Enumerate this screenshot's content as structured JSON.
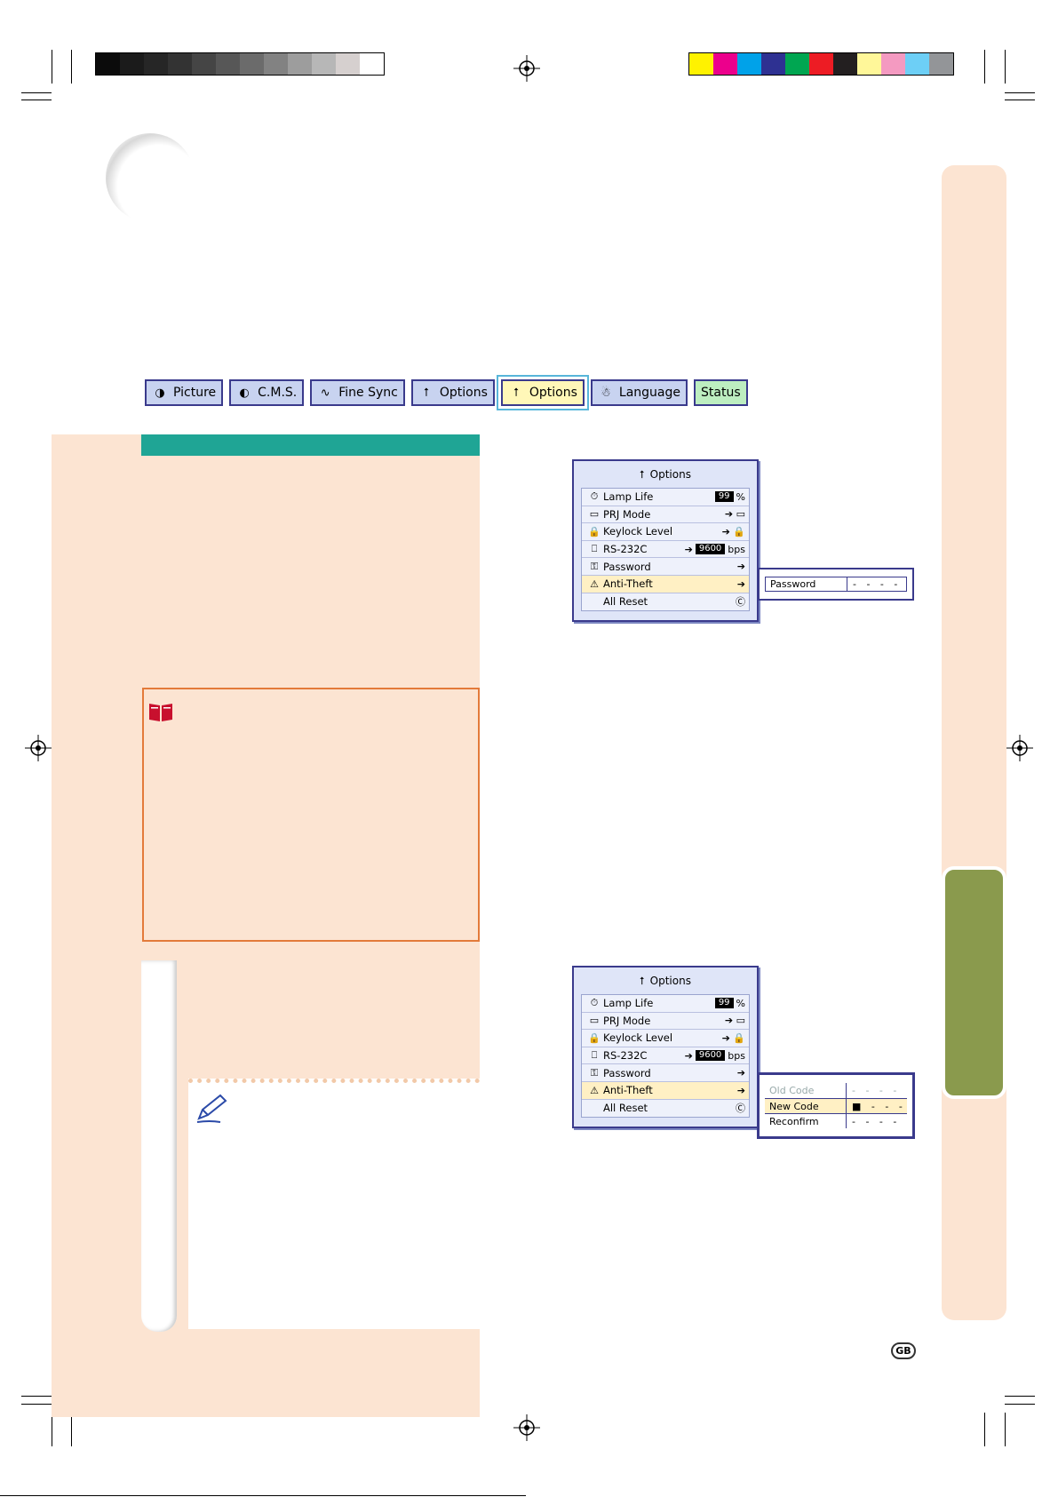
{
  "print_marks": {
    "gray_swatches": [
      "#0b0b0b",
      "#1b1b1b",
      "#262626",
      "#333333",
      "#454545",
      "#575757",
      "#6b6b6b",
      "#828282",
      "#9d9d9d",
      "#b7b7b7",
      "#d6d0cf",
      "#ffffff"
    ],
    "color_swatches": [
      "#fff200",
      "#ec008c",
      "#00a2e9",
      "#2e3192",
      "#00a651",
      "#ed1c24",
      "#231f20",
      "#fff799",
      "#f49ac1",
      "#6dcff6",
      "#939598"
    ]
  },
  "menu_tabs": [
    {
      "label": "Picture",
      "icon": "picture-icon"
    },
    {
      "label": "C.M.S.",
      "icon": "cms-icon"
    },
    {
      "label": "Fine Sync",
      "icon": "fine-sync-icon"
    },
    {
      "label": "Options",
      "icon": "options-icon"
    },
    {
      "label": "Options",
      "icon": "options-icon",
      "selected": true
    },
    {
      "label": "Language",
      "icon": "language-icon"
    },
    {
      "label": "Status",
      "icon": ""
    }
  ],
  "menu1": {
    "title": "Options",
    "rows": [
      {
        "label": "Lamp Life",
        "value": "99",
        "unit": "%"
      },
      {
        "label": "PRJ Mode",
        "value": "",
        "unit": ""
      },
      {
        "label": "Keylock Level",
        "value": "",
        "unit": ""
      },
      {
        "label": "RS-232C",
        "value": "9600",
        "unit": "bps"
      },
      {
        "label": "Password",
        "value": "",
        "unit": ""
      },
      {
        "label": "Anti-Theft",
        "value": "",
        "unit": ""
      },
      {
        "label": "All Reset",
        "value": "",
        "unit": ""
      }
    ],
    "sub": [
      {
        "label": "Password",
        "value": "- - - -"
      }
    ]
  },
  "menu2": {
    "title": "Options",
    "rows": [
      {
        "label": "Lamp Life",
        "value": "99",
        "unit": "%"
      },
      {
        "label": "PRJ Mode",
        "value": "",
        "unit": ""
      },
      {
        "label": "Keylock Level",
        "value": "",
        "unit": ""
      },
      {
        "label": "RS-232C",
        "value": "9600",
        "unit": "bps"
      },
      {
        "label": "Password",
        "value": "",
        "unit": ""
      },
      {
        "label": "Anti-Theft",
        "value": "",
        "unit": ""
      },
      {
        "label": "All Reset",
        "value": "",
        "unit": ""
      }
    ],
    "sub": [
      {
        "label": "Old Code",
        "value": "- - - -"
      },
      {
        "label": "New Code",
        "value": "■ - - -"
      },
      {
        "label": "Reconfirm",
        "value": "- - - -"
      }
    ]
  },
  "footer": {
    "badge": "GB"
  }
}
